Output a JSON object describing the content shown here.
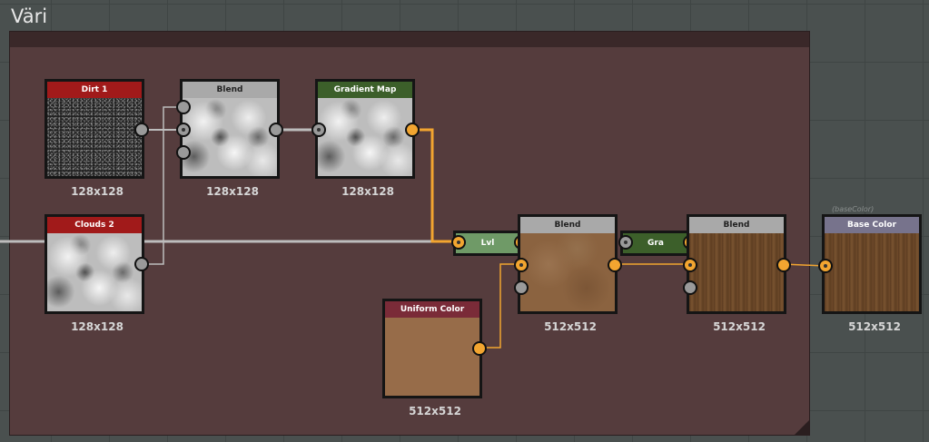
{
  "frame": {
    "title": "Väri"
  },
  "nodes": {
    "dirt": {
      "label": "Dirt 1",
      "size": "128x128"
    },
    "blend_gray": {
      "label": "Blend",
      "size": "128x128"
    },
    "gradient_map": {
      "label": "Gradient Map",
      "size": "128x128"
    },
    "clouds": {
      "label": "Clouds 2",
      "size": "128x128"
    },
    "lvl": {
      "label": "Lvl"
    },
    "blend_color": {
      "label": "Blend",
      "size": "512x512"
    },
    "gra": {
      "label": "Gra"
    },
    "blend_wood": {
      "label": "Blend",
      "size": "512x512"
    },
    "uniform_color": {
      "label": "Uniform Color",
      "size": "512x512"
    },
    "base_color": {
      "label": "Base Color",
      "size": "512x512",
      "identifier": "(baseColor)"
    }
  },
  "colors": {
    "frame_bg": "#553c3d",
    "header_red": "#a11a1a",
    "header_green": "#3c5f2a",
    "header_gray": "#a9a9a9",
    "header_maroon": "#7a2b38",
    "header_lavender": "#77738c",
    "wire_gray": "#bdbdbd",
    "wire_orange": "#f2a530"
  }
}
